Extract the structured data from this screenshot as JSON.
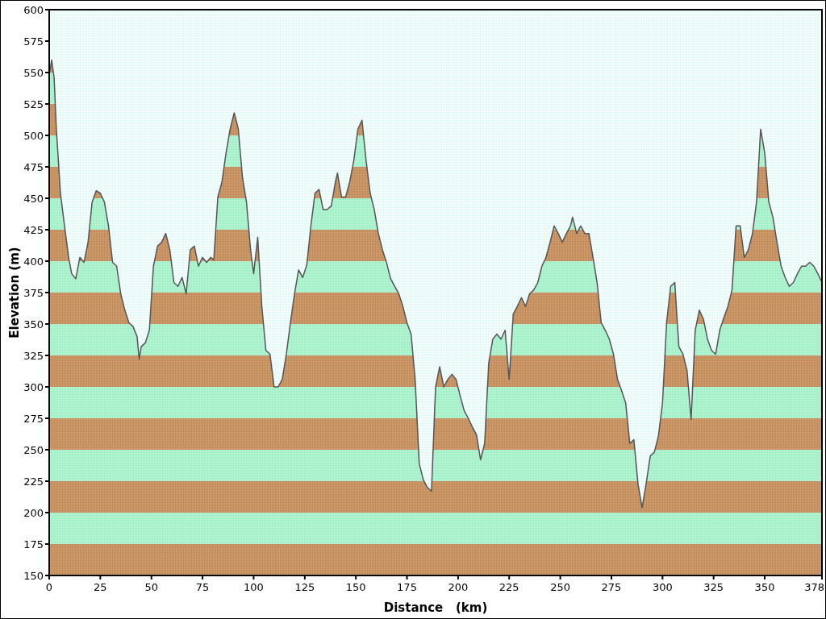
{
  "chart": {
    "chart_data": {
      "type": "area",
      "xlabel": "Distance   (km)",
      "ylabel": "Elevation (m)",
      "xlim": [
        0,
        378
      ],
      "ylim": [
        150,
        600
      ],
      "xticks": [
        0,
        25,
        50,
        75,
        100,
        125,
        150,
        175,
        200,
        225,
        250,
        275,
        300,
        325,
        350,
        378
      ],
      "yticks": [
        150,
        175,
        200,
        225,
        250,
        275,
        300,
        325,
        350,
        375,
        400,
        425,
        450,
        475,
        500,
        525,
        550,
        575,
        600
      ],
      "x": [
        0,
        1.2,
        2.4,
        3.5,
        5.5,
        7.5,
        9.5,
        11,
        13,
        15,
        17,
        19,
        21,
        23,
        25,
        27,
        29,
        31,
        33,
        35,
        37,
        39,
        41,
        43,
        44,
        45,
        47,
        49,
        51,
        53,
        55,
        57,
        59,
        61,
        63,
        65,
        67,
        69,
        71,
        73,
        75,
        77,
        79,
        80.5,
        82.5,
        84.5,
        86.5,
        88.5,
        90.5,
        92.5,
        94.5,
        96.5,
        98.5,
        100,
        102,
        104,
        106,
        108,
        110,
        112,
        114,
        116,
        118,
        120,
        122,
        124,
        126,
        128,
        130,
        132,
        134,
        136,
        138,
        140,
        141,
        143,
        145,
        147,
        149,
        151,
        153,
        155,
        157,
        159,
        161,
        163,
        165,
        167,
        169,
        171,
        173,
        175,
        177,
        179,
        181,
        183,
        185,
        187,
        189,
        191,
        193,
        195,
        197,
        199,
        201,
        203,
        205,
        207,
        209,
        211,
        213,
        215,
        217,
        219,
        221,
        223,
        225,
        227,
        229,
        231,
        233,
        235,
        237,
        239,
        241,
        243,
        245,
        247,
        249,
        251,
        253,
        255,
        256,
        258,
        260,
        262,
        264,
        266,
        268,
        270,
        272,
        274,
        276,
        278,
        280,
        282,
        284,
        286,
        288,
        290,
        292,
        294,
        296,
        298,
        300,
        302,
        304,
        306,
        308,
        310,
        312,
        314,
        316,
        318,
        320,
        322,
        324,
        326,
        328,
        330,
        332,
        334,
        336,
        338,
        340,
        342,
        344,
        346,
        348,
        350,
        352,
        354,
        356,
        358,
        360,
        362,
        364,
        366,
        368,
        370,
        372,
        374,
        376,
        378
      ],
      "series": [
        {
          "color": "#555555",
          "values": [
            548,
            560,
            546,
            505,
            454,
            428,
            403,
            390,
            386,
            403,
            399,
            415,
            447,
            456,
            454,
            447,
            428,
            399,
            396,
            374,
            361,
            351,
            348,
            340,
            322,
            332,
            335,
            345,
            396,
            412,
            415,
            422,
            409,
            383,
            380,
            387,
            374,
            409,
            412,
            396,
            403,
            399,
            403,
            401,
            451,
            463,
            486,
            505,
            518,
            505,
            467,
            447,
            409,
            390,
            419,
            364,
            329,
            326,
            300,
            300,
            306,
            326,
            351,
            374,
            393,
            387,
            397,
            428,
            454,
            457,
            441,
            441,
            444,
            463,
            470,
            451,
            451,
            463,
            480,
            505,
            512,
            480,
            454,
            441,
            422,
            409,
            399,
            386,
            380,
            374,
            364,
            351,
            342,
            306,
            239,
            226,
            220,
            217,
            300,
            316,
            300,
            306,
            310,
            306,
            293,
            281,
            275,
            268,
            262,
            242,
            255,
            319,
            338,
            342,
            338,
            345,
            306,
            358,
            364,
            371,
            364,
            374,
            377,
            383,
            396,
            403,
            415,
            428,
            422,
            415,
            422,
            428,
            435,
            422,
            428,
            422,
            422,
            403,
            383,
            351,
            345,
            338,
            326,
            306,
            297,
            287,
            255,
            258,
            223,
            204,
            223,
            245,
            248,
            261,
            287,
            351,
            380,
            383,
            332,
            326,
            313,
            274,
            345,
            361,
            354,
            338,
            329,
            326,
            345,
            355,
            364,
            377,
            428,
            428,
            403,
            409,
            422,
            447,
            505,
            486,
            447,
            435,
            415,
            396,
            387,
            380,
            383,
            390,
            396,
            396,
            399,
            396,
            390,
            383
          ]
        }
      ]
    }
  }
}
